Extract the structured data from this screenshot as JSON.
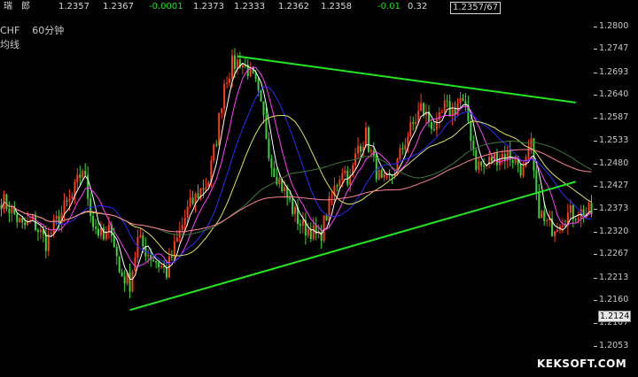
{
  "quote_bar": {
    "name": "瑞　郎",
    "open": "1.2357",
    "high": "1.2367",
    "change": "-0.0001",
    "last": "1.2373",
    "low": "1.2333",
    "ask": "1.2362",
    "bid": "1.2358",
    "change2": "-0.01",
    "amplitude": "0.32",
    "box": "1.2357/67"
  },
  "chart_header": {
    "symbol": "CHF",
    "period": "60分钟",
    "type": "均线"
  },
  "watermark": "KEKSOFT.COM",
  "colors": {
    "background": "#000000",
    "up_candle": "#ff3b1a",
    "down_candle": "#3cd23c",
    "trendline": "#22e622",
    "ma_fast": "#ffffff",
    "ma_mid1": "#ff40ff",
    "ma_mid2": "#2a2aff",
    "ma_mid3": "#e0e060",
    "ma_slow1": "#3a7a3a",
    "ma_slow2": "#ff8090"
  },
  "chart_data": {
    "type": "candlestick",
    "ylim": [
      1.203,
      1.281
    ],
    "y_ticks": [
      "1.2800",
      "1.2747",
      "1.2693",
      "1.2640",
      "1.2587",
      "1.2533",
      "1.2480",
      "1.2427",
      "1.2373",
      "1.2320",
      "1.2267",
      "1.2213",
      "1.2160",
      "1.2107",
      "1.2053"
    ],
    "current_price": "1.2124",
    "bar_count": 226,
    "trendlines": [
      {
        "name": "resistance",
        "from": [
          90,
          1.273
        ],
        "to": [
          219,
          1.2622
        ]
      },
      {
        "name": "support",
        "from": [
          49,
          1.2137
        ],
        "to": [
          219,
          1.2437
        ]
      }
    ],
    "path_anchors": [
      [
        0,
        1.2395
      ],
      [
        4,
        1.237
      ],
      [
        8,
        1.233
      ],
      [
        12,
        1.2345
      ],
      [
        17,
        1.2295
      ],
      [
        22,
        1.2355
      ],
      [
        27,
        1.24
      ],
      [
        31,
        1.247
      ],
      [
        35,
        1.234
      ],
      [
        39,
        1.23
      ],
      [
        42,
        1.233
      ],
      [
        45,
        1.2225
      ],
      [
        49,
        1.22
      ],
      [
        52,
        1.23
      ],
      [
        56,
        1.227
      ],
      [
        60,
        1.2245
      ],
      [
        63,
        1.2225
      ],
      [
        67,
        1.23
      ],
      [
        71,
        1.237
      ],
      [
        75,
        1.241
      ],
      [
        79,
        1.244
      ],
      [
        82,
        1.254
      ],
      [
        85,
        1.267
      ],
      [
        88,
        1.271
      ],
      [
        91,
        1.272
      ],
      [
        94,
        1.27
      ],
      [
        97,
        1.266
      ],
      [
        100,
        1.258
      ],
      [
        103,
        1.248
      ],
      [
        106,
        1.244
      ],
      [
        109,
        1.24
      ],
      [
        112,
        1.236
      ],
      [
        115,
        1.233
      ],
      [
        118,
        1.2325
      ],
      [
        121,
        1.23
      ],
      [
        124,
        1.236
      ],
      [
        127,
        1.242
      ],
      [
        130,
        1.247
      ],
      [
        133,
        1.244
      ],
      [
        136,
        1.252
      ],
      [
        139,
        1.2545
      ],
      [
        142,
        1.248
      ],
      [
        145,
        1.243
      ],
      [
        148,
        1.244
      ],
      [
        151,
        1.248
      ],
      [
        154,
        1.2535
      ],
      [
        157,
        1.257
      ],
      [
        160,
        1.261
      ],
      [
        163,
        1.258
      ],
      [
        166,
        1.256
      ],
      [
        169,
        1.261
      ],
      [
        172,
        1.26
      ],
      [
        175,
        1.263
      ],
      [
        178,
        1.258
      ],
      [
        181,
        1.248
      ],
      [
        184,
        1.247
      ],
      [
        187,
        1.249
      ],
      [
        190,
        1.25
      ],
      [
        193,
        1.25
      ],
      [
        196,
        1.249
      ],
      [
        199,
        1.246
      ],
      [
        202,
        1.252
      ],
      [
        204,
        1.239
      ],
      [
        207,
        1.234
      ],
      [
        210,
        1.233
      ],
      [
        213,
        1.235
      ],
      [
        216,
        1.236
      ],
      [
        219,
        1.2365
      ]
    ],
    "ma_periods": [
      5,
      10,
      20,
      30,
      60,
      120
    ]
  }
}
